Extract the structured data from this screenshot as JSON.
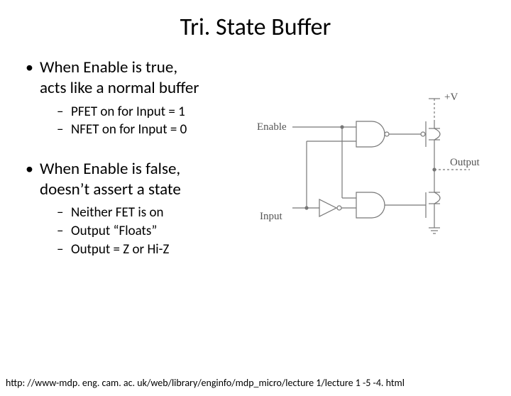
{
  "title": "Tri. State Buffer",
  "section1": {
    "bullet_l1": "When Enable is true,",
    "bullet_l2": "acts like a normal buffer",
    "sub1": "PFET on for Input = 1",
    "sub2": "NFET on for Input = 0"
  },
  "section2": {
    "bullet_l1": "When Enable is false,",
    "bullet_l2": "doesn’t assert a state",
    "sub1": "Neither FET is on",
    "sub2": "Output “Floats”",
    "sub3": "Output = Z or Hi-Z"
  },
  "diagram": {
    "enable": "Enable",
    "input": "Input",
    "output": "Output",
    "vcc": "+V"
  },
  "footer": "http: //www-mdp. eng. cam. ac. uk/web/library/enginfo/mdp_micro/lecture 1/lecture 1 -5 -4. html"
}
